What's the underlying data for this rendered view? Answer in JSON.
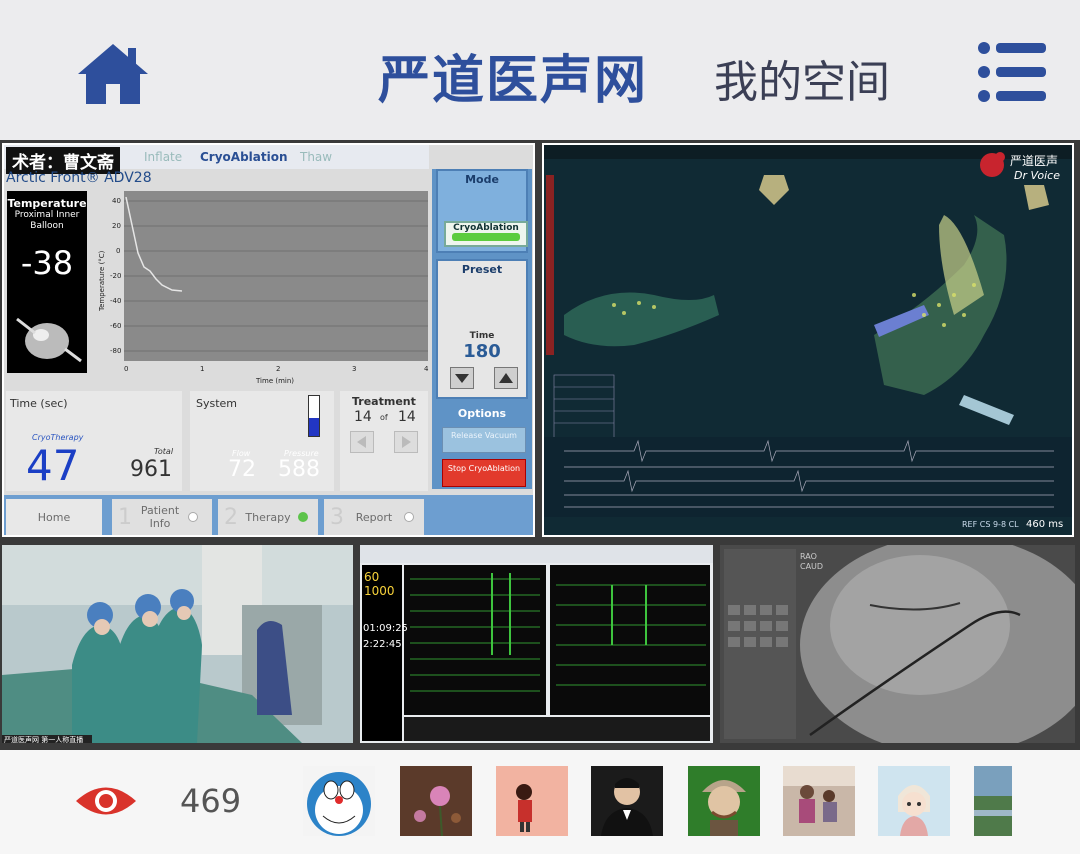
{
  "header": {
    "brand": "严道医声网",
    "my_space": "我的空间",
    "home_icon": "home-icon",
    "menu_icon": "menu-icon",
    "brand_color": "#2e4f9c"
  },
  "cryo_console": {
    "author": "术者：曹文斋",
    "tabs": [
      "Inflate",
      "CryoAblation",
      "Thaw"
    ],
    "device": "Arctic Front® ADV28",
    "temperature": {
      "title": "Temperature",
      "sub": "Proximal Inner Balloon",
      "value": "-38"
    },
    "plot": {
      "ylabel": "Temperature (°C)",
      "xlabel": "Time (min)",
      "yticks": [
        "40",
        "20",
        "0",
        "-20",
        "-40",
        "-60",
        "-80"
      ],
      "xticks": [
        "0",
        "1",
        "2",
        "3",
        "4"
      ]
    },
    "mode": {
      "title": "Mode",
      "button": "CryoAblation"
    },
    "preset": {
      "title": "Preset",
      "time_label": "Time",
      "time_value": "180"
    },
    "options": {
      "title": "Options",
      "release": "Release Vacuum",
      "stop": "Stop CryoAblation"
    },
    "time": {
      "title": "Time (sec)",
      "cryo_label": "CryoTherapy",
      "cryo_value": "47",
      "total_label": "Total",
      "total_value": "961"
    },
    "system": {
      "title": "System",
      "flow_label": "Flow",
      "flow_value": "72",
      "pressure_label": "Pressure",
      "pressure_value": "588"
    },
    "treatment": {
      "title": "Treatment",
      "current": "14",
      "of": "of",
      "total": "14"
    },
    "nav": [
      {
        "num": "",
        "label": "Home"
      },
      {
        "num": "1",
        "label": "Patient Info"
      },
      {
        "num": "2",
        "label": "Therapy"
      },
      {
        "num": "3",
        "label": "Report"
      }
    ]
  },
  "mapping": {
    "logo_text": "严道医声",
    "logo_sub": "Dr Voice",
    "footer_label": "REF CS 9-8 CL",
    "footer_value": "460 ms"
  },
  "ep_recorder": {
    "rate": "60",
    "speed": "1000",
    "time1": "01:09:25",
    "time2": "2:22:45"
  },
  "fluoro": {
    "label1": "RAO",
    "label2": "CAUD"
  },
  "video": {
    "caption": "严道医声网 第一人称直播"
  },
  "footer": {
    "eye_icon": "eye-icon",
    "view_count": "469",
    "avatars": [
      "doraemon",
      "flower",
      "girl-illustration",
      "man-portrait",
      "cartoon-chef",
      "family-photo",
      "anime-girl",
      "landscape"
    ]
  }
}
